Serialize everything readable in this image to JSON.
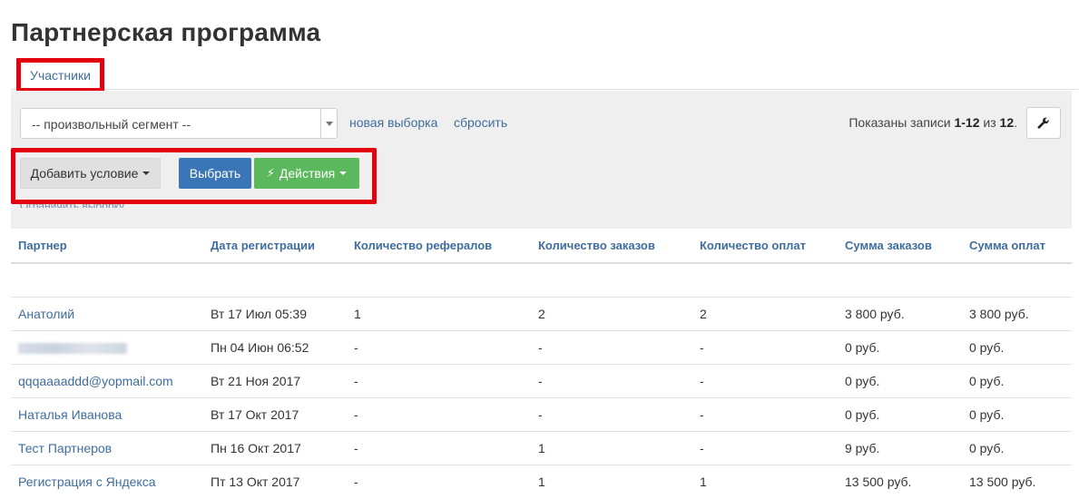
{
  "page": {
    "title": "Партнерская программа"
  },
  "tabs": [
    {
      "label": "Участники"
    }
  ],
  "toolbar": {
    "segment_value": "-- произвольный сегмент --",
    "new_selection": "новая выборка",
    "reset": "сбросить",
    "records_prefix": "Показаны записи ",
    "records_range": "1-12",
    "records_of": " из ",
    "records_total": "12",
    "records_suffix": ".",
    "add_condition": "Добавить условие",
    "select": "Выбрать",
    "actions": "Действия",
    "hint": "Ограничить выборку"
  },
  "table": {
    "columns": [
      "Партнер",
      "Дата регистрации",
      "Количество рефералов",
      "Количество заказов",
      "Количество оплат",
      "Сумма заказов",
      "Сумма оплат"
    ],
    "rows": [
      {
        "name": "Анатолий",
        "date": "Вт 17 Июл 05:39",
        "referrals": "1",
        "orders": "2",
        "payments": "2",
        "orders_sum": "3 800 руб.",
        "payments_sum": "3 800 руб."
      },
      {
        "name": "",
        "date": "Пн 04 Июн 06:52",
        "referrals": "-",
        "orders": "-",
        "payments": "-",
        "orders_sum": "0 руб.",
        "payments_sum": "0 руб."
      },
      {
        "name": "qqqaaaaddd@yopmail.com",
        "date": "Вт 21 Ноя 2017",
        "referrals": "-",
        "orders": "-",
        "payments": "-",
        "orders_sum": "0 руб.",
        "payments_sum": "0 руб."
      },
      {
        "name": "Наталья Иванова",
        "date": "Вт 17 Окт 2017",
        "referrals": "-",
        "orders": "-",
        "payments": "-",
        "orders_sum": "0 руб.",
        "payments_sum": "0 руб."
      },
      {
        "name": "Тест Партнеров",
        "date": "Пн 16 Окт 2017",
        "referrals": "-",
        "orders": "1",
        "payments": "-",
        "orders_sum": "9 руб.",
        "payments_sum": "0 руб."
      },
      {
        "name": "Регистрация с Яндекса",
        "date": "Пт 13 Окт 2017",
        "referrals": "-",
        "orders": "1",
        "payments": "1",
        "orders_sum": "13 500 руб.",
        "payments_sum": "13 500 руб."
      }
    ]
  },
  "colors": {
    "link": "#3f6d9e",
    "primary": "#3a76b7",
    "success": "#5bb85c",
    "highlight": "#e3000f"
  }
}
